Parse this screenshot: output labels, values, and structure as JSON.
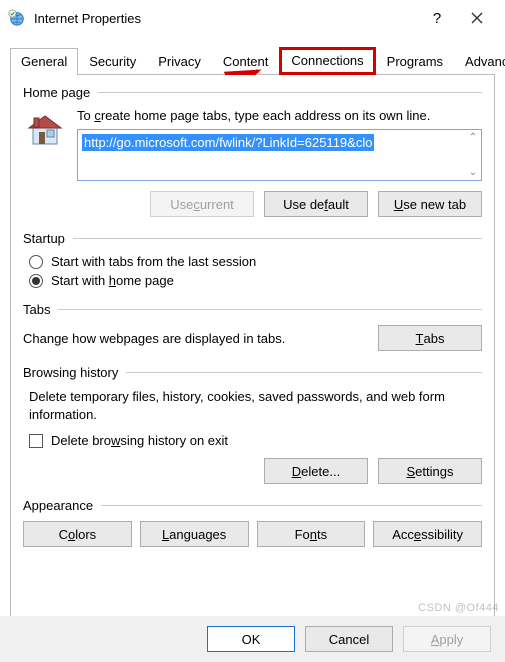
{
  "title": "Internet Properties",
  "tabs": [
    "General",
    "Security",
    "Privacy",
    "Content",
    "Connections",
    "Programs",
    "Advanced"
  ],
  "home": {
    "group": "Home page",
    "instruction_pre": "To ",
    "instruction_u": "c",
    "instruction_post": "reate home page tabs, type each address on its own line.",
    "url": "http://go.microsoft.com/fwlink/?LinkId=625119&clo",
    "buttons": {
      "use_current_pre": "Use ",
      "use_current_u": "c",
      "use_current_post": "urrent",
      "use_default_pre": "Use de",
      "use_default_u": "f",
      "use_default_post": "ault",
      "use_new_pre": "",
      "use_new_u": "U",
      "use_new_post": "se new tab"
    }
  },
  "startup": {
    "group": "Startup",
    "opt1_pre": "Start with tabs from the last session",
    "opt1_u": "",
    "opt1_post": "",
    "opt2_pre": "Start with ",
    "opt2_u": "h",
    "opt2_post": "ome page"
  },
  "tabs_section": {
    "group": "Tabs",
    "text": "Change how webpages are displayed in tabs.",
    "btn_u": "T",
    "btn_post": "abs"
  },
  "history": {
    "group": "Browsing history",
    "text": "Delete temporary files, history, cookies, saved passwords, and web form information.",
    "check_pre": "Delete bro",
    "check_u": "w",
    "check_post": "sing history on exit",
    "delete_u": "D",
    "delete_post": "elete...",
    "settings_u": "S",
    "settings_post": "ettings"
  },
  "appearance": {
    "group": "Appearance",
    "colors_pre": "C",
    "colors_u": "o",
    "colors_post": "lors",
    "lang_u": "L",
    "lang_post": "anguages",
    "fonts_pre": "Fo",
    "fonts_u": "n",
    "fonts_post": "ts",
    "acc_pre": "Acc",
    "acc_u": "e",
    "acc_post": "ssibility"
  },
  "bottom": {
    "ok": "OK",
    "cancel": "Cancel",
    "apply_u": "A",
    "apply_post": "pply"
  },
  "watermark": "CSDN @Of444"
}
